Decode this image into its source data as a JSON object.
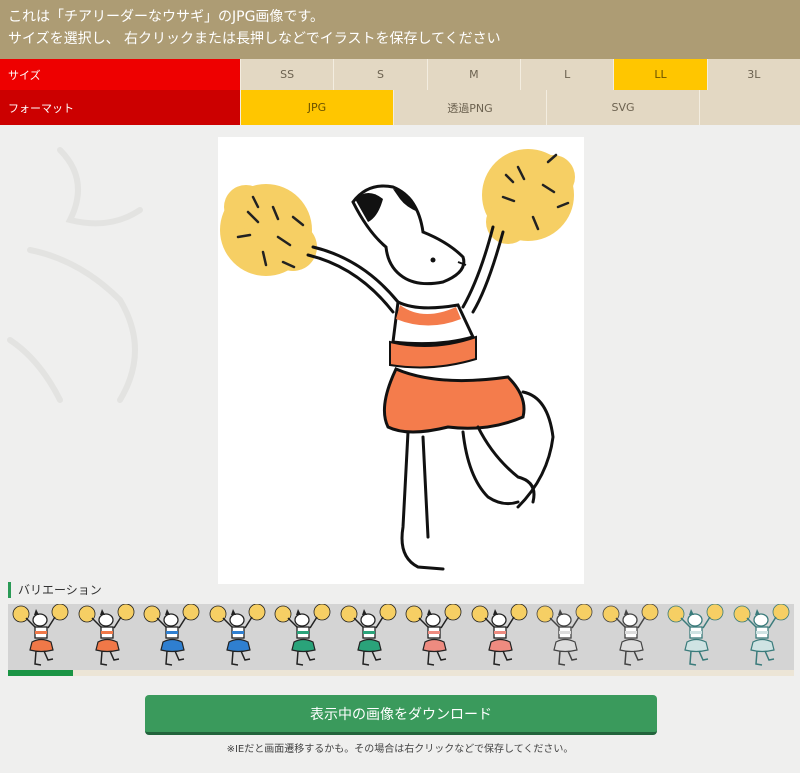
{
  "banner": {
    "line1": "これは「チアリーダーなウサギ」のJPG画像です。",
    "line2": "サイズを選択し、 右クリックまたは長押しなどでイラストを保存してください"
  },
  "size_row": {
    "label": "サイズ",
    "options": [
      "SS",
      "S",
      "M",
      "L",
      "LL",
      "3L"
    ],
    "selected": "LL"
  },
  "format_row": {
    "label": "フォーマット",
    "options": [
      "JPG",
      "透過PNG",
      "SVG"
    ],
    "selected": "JPG"
  },
  "variations": {
    "heading": "バリエーション",
    "skirt_colors": [
      "#f07848",
      "#f07848",
      "#2f7fd0",
      "#2f7fd0",
      "#2aa37a",
      "#2aa37a",
      "#ee8b80",
      "#ee8b80",
      "#dddddd",
      "#dddddd",
      "#cfe3e3",
      "#cfe3e3"
    ],
    "line_colors": [
      "#222222",
      "#222222",
      "#222222",
      "#222222",
      "#222222",
      "#222222",
      "#222222",
      "#222222",
      "#444444",
      "#444444",
      "#3a7b7b",
      "#3a7b7b"
    ],
    "progress": 0.083
  },
  "download": {
    "button_label": "表示中の画像をダウンロード",
    "note": "※IEだと画面遷移するかも。その場合は右クリックなどで保存してください。"
  },
  "colors": {
    "banner_bg": "#ad9c74",
    "size_label_bg": "#ee0000",
    "format_label_bg": "#cc0000",
    "selected_option": "#ffc600",
    "download_button": "#3a9a5c"
  }
}
